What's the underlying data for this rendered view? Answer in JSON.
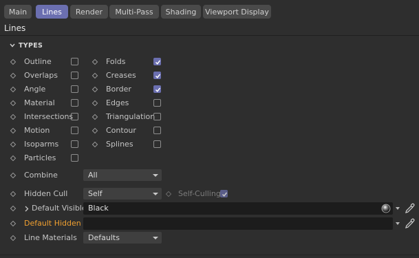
{
  "tabs": [
    {
      "label": "Main",
      "active": false
    },
    {
      "label": "Lines",
      "active": true
    },
    {
      "label": "Render",
      "active": false
    },
    {
      "label": "Multi-Pass",
      "active": false
    },
    {
      "label": "Shading",
      "active": false
    },
    {
      "label": "Viewport Display",
      "active": false
    }
  ],
  "page_title": "Lines",
  "section": {
    "title": "TYPES",
    "expanded": true
  },
  "types_left": [
    {
      "label": "Outline",
      "checked": false
    },
    {
      "label": "Overlaps",
      "checked": false
    },
    {
      "label": "Angle",
      "checked": false
    },
    {
      "label": "Material",
      "checked": false
    },
    {
      "label": "Intersections",
      "checked": false
    },
    {
      "label": "Motion",
      "checked": false
    },
    {
      "label": "Isoparms",
      "checked": false
    },
    {
      "label": "Particles",
      "checked": false
    }
  ],
  "types_right": [
    {
      "label": "Folds",
      "checked": true
    },
    {
      "label": "Creases",
      "checked": true
    },
    {
      "label": "Border",
      "checked": true
    },
    {
      "label": "Edges",
      "checked": false
    },
    {
      "label": "Triangulation",
      "checked": false
    },
    {
      "label": "Contour",
      "checked": false
    },
    {
      "label": "Splines",
      "checked": false
    }
  ],
  "combine": {
    "label": "Combine",
    "value": "All"
  },
  "hidden_cull": {
    "label": "Hidden Cull",
    "value": "Self",
    "self_culling_label": "Self-Culling",
    "self_culling_checked": true
  },
  "default_visible": {
    "label": "Default Visible",
    "value": "Black"
  },
  "default_hidden": {
    "label": "Default Hidden",
    "value": ""
  },
  "line_materials": {
    "label": "Line Materials",
    "value": "Defaults"
  },
  "colors": {
    "accent": "#6b6fb0",
    "orange_label": "#f0a030",
    "background": "#2e2e2e"
  }
}
